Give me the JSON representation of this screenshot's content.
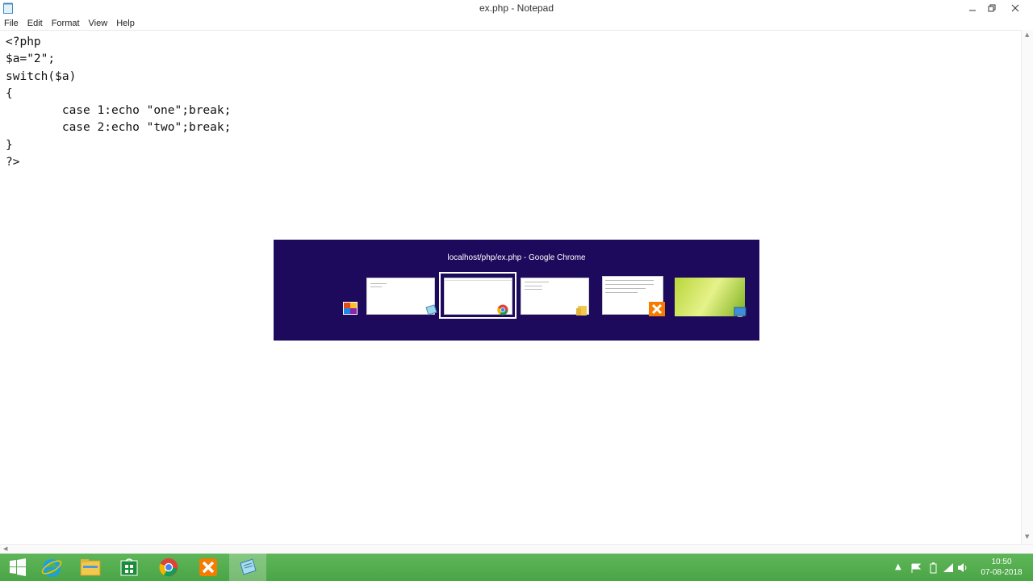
{
  "window": {
    "title": "ex.php - Notepad"
  },
  "menu": [
    "File",
    "Edit",
    "Format",
    "View",
    "Help"
  ],
  "editor": {
    "lines": [
      "<?php",
      "$a=\"2\";",
      "switch($a)",
      "{",
      "        case 1:echo \"one\";break;",
      "        case 2:echo \"two\";break;",
      "}",
      "?>"
    ]
  },
  "switcher": {
    "title": "localhost/php/ex.php - Google Chrome",
    "items": [
      "desktop-icon",
      "notepad-window",
      "chrome-window",
      "explorer-window",
      "xampp-window",
      "desktop-background"
    ]
  },
  "taskbar": {
    "apps": [
      "windows-start-icon",
      "internet-explorer-icon",
      "file-explorer-icon",
      "store-icon",
      "chrome-icon",
      "xampp-icon",
      "notepad-icon"
    ],
    "time": "10:50",
    "date": "07-08-2018"
  },
  "colors": {
    "switcher_bg": "#1e0a5c",
    "taskbar": "#4aa545"
  }
}
